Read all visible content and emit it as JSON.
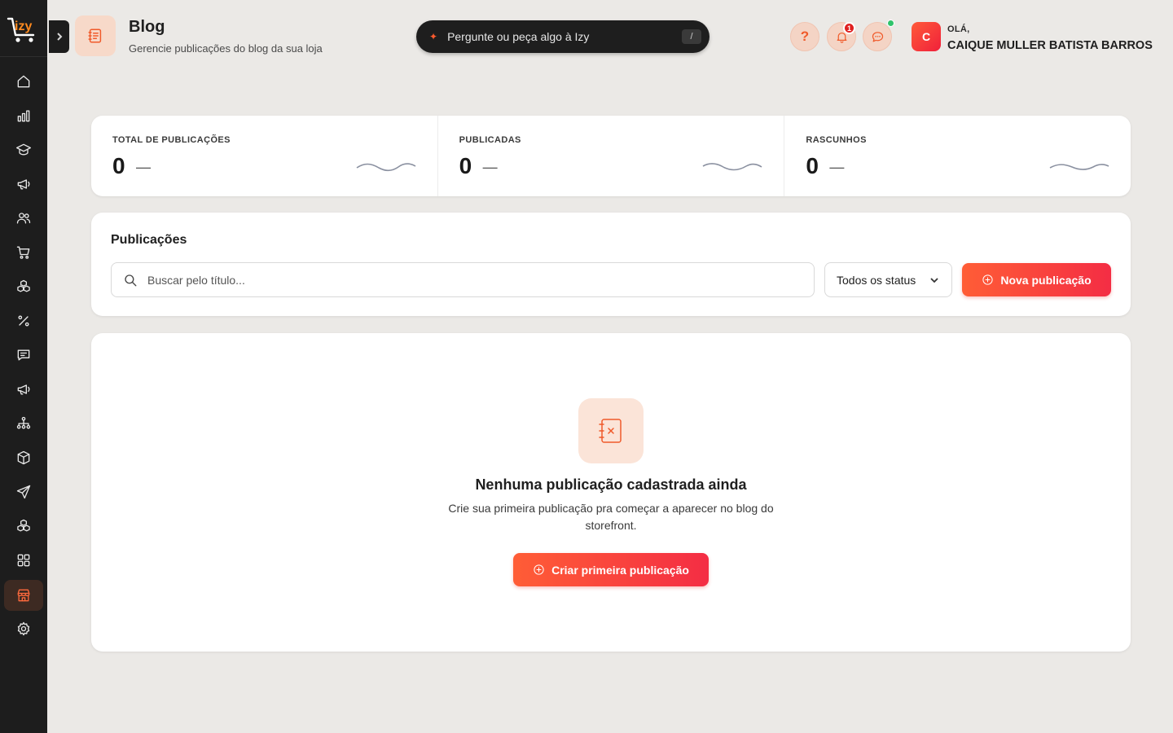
{
  "app": {
    "logo_text": "izy"
  },
  "sidebar": {
    "items": [
      {
        "name": "home-icon"
      },
      {
        "name": "bar-chart-icon"
      },
      {
        "name": "graduation-cap-icon"
      },
      {
        "name": "megaphone-icon"
      },
      {
        "name": "users-icon"
      },
      {
        "name": "cart-icon"
      },
      {
        "name": "boxes-icon"
      },
      {
        "name": "percent-icon"
      },
      {
        "name": "message-icon"
      },
      {
        "name": "megaphone-2-icon"
      },
      {
        "name": "org-chart-icon"
      },
      {
        "name": "package-icon"
      },
      {
        "name": "send-icon"
      },
      {
        "name": "boxes-2-icon"
      },
      {
        "name": "grid-icon"
      },
      {
        "name": "store-icon",
        "active": true
      },
      {
        "name": "settings-icon"
      }
    ]
  },
  "header": {
    "title": "Blog",
    "subtitle": "Gerencie publicações do blog da sua loja",
    "ai_prompt": "Pergunte ou peça algo à Izy",
    "ai_shortcut": "/",
    "help_label": "?",
    "notification_count": "1",
    "greeting": "OLÁ,",
    "user_name": "CAIQUE MULLER BATISTA BARROS",
    "avatar_initial": "C"
  },
  "stats": [
    {
      "label": "TOTAL DE PUBLICAÇÕES",
      "value": "0",
      "trend": "—"
    },
    {
      "label": "PUBLICADAS",
      "value": "0",
      "trend": "—"
    },
    {
      "label": "RASCUNHOS",
      "value": "0",
      "trend": "—"
    }
  ],
  "publications": {
    "title": "Publicações",
    "search_placeholder": "Buscar pelo título...",
    "status_filter": "Todos os status",
    "new_button": "Nova publicação"
  },
  "empty_state": {
    "title": "Nenhuma publicação cadastrada ainda",
    "description": "Crie sua primeira publicação pra começar a aparecer no blog do storefront.",
    "cta": "Criar primeira publicação"
  },
  "colors": {
    "accent": "#f05a2a",
    "sidebar_bg": "#1d1d1d",
    "page_bg": "#ebe9e6",
    "primary_gradient_start": "#ff5d36",
    "primary_gradient_end": "#f42d44"
  }
}
